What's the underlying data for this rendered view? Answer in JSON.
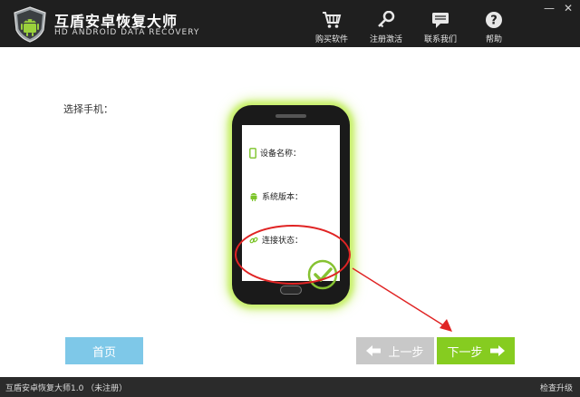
{
  "header": {
    "title": "互盾安卓恢复大师",
    "subtitle": "HD ANDROID DATA RECOVERY",
    "minimize_label": "—",
    "close_label": "✕",
    "tools": [
      {
        "label": "购买软件",
        "icon": "cart-icon"
      },
      {
        "label": "注册激活",
        "icon": "key-icon"
      },
      {
        "label": "联系我们",
        "icon": "chat-icon"
      },
      {
        "label": "帮助",
        "icon": "help-icon"
      }
    ]
  },
  "main": {
    "select_phone_label": "选择手机：",
    "device_name_label": "设备名称：",
    "system_version_label": "系统版本：",
    "connection_status_label": "连接状态："
  },
  "buttons": {
    "home": "首页",
    "prev": "上一步",
    "next": "下一步"
  },
  "footer": {
    "version_text": "互盾安卓恢复大师1.0 （未注册）",
    "check_update": "检查升级"
  },
  "colors": {
    "header_bg": "#1f1f1f",
    "glow": "#c8f06a",
    "home_button": "#7ec8e8",
    "prev_button": "#c8c8c8",
    "next_button": "#86cc20",
    "annotation_red": "#e02424",
    "check_green": "#86c232"
  }
}
